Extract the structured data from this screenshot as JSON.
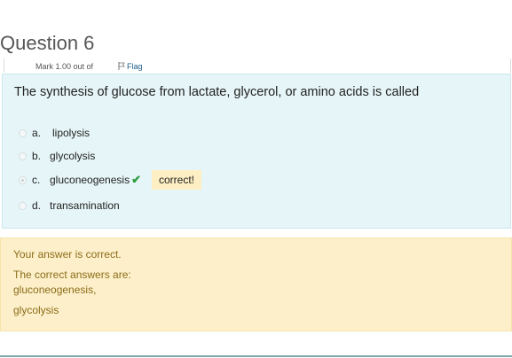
{
  "question": {
    "title": "Question 6",
    "mark": "Mark 1.00 out of",
    "flag_label": "Flag",
    "text": "The synthesis of glucose from lactate, glycerol, or amino acids is called",
    "options": [
      {
        "letter": "a.",
        "label": "lipolysis",
        "selected": false
      },
      {
        "letter": "b.",
        "label": "glycolysis",
        "selected": false
      },
      {
        "letter": "c.",
        "label": "gluconeogenesis",
        "selected": true
      },
      {
        "letter": "d.",
        "label": "transamination",
        "selected": false
      }
    ],
    "correct_badge": "correct!"
  },
  "feedback": {
    "status": "Your answer is correct.",
    "answers_heading": "The correct answers are:",
    "answer_1": "gluconeogenesis,",
    "answer_2": "glycolysis"
  },
  "colors": {
    "question_bg": "#e6f5f7",
    "feedback_bg": "#fdefc9",
    "feedback_text": "#8a6d1a",
    "check_green": "#2e9c3c"
  }
}
